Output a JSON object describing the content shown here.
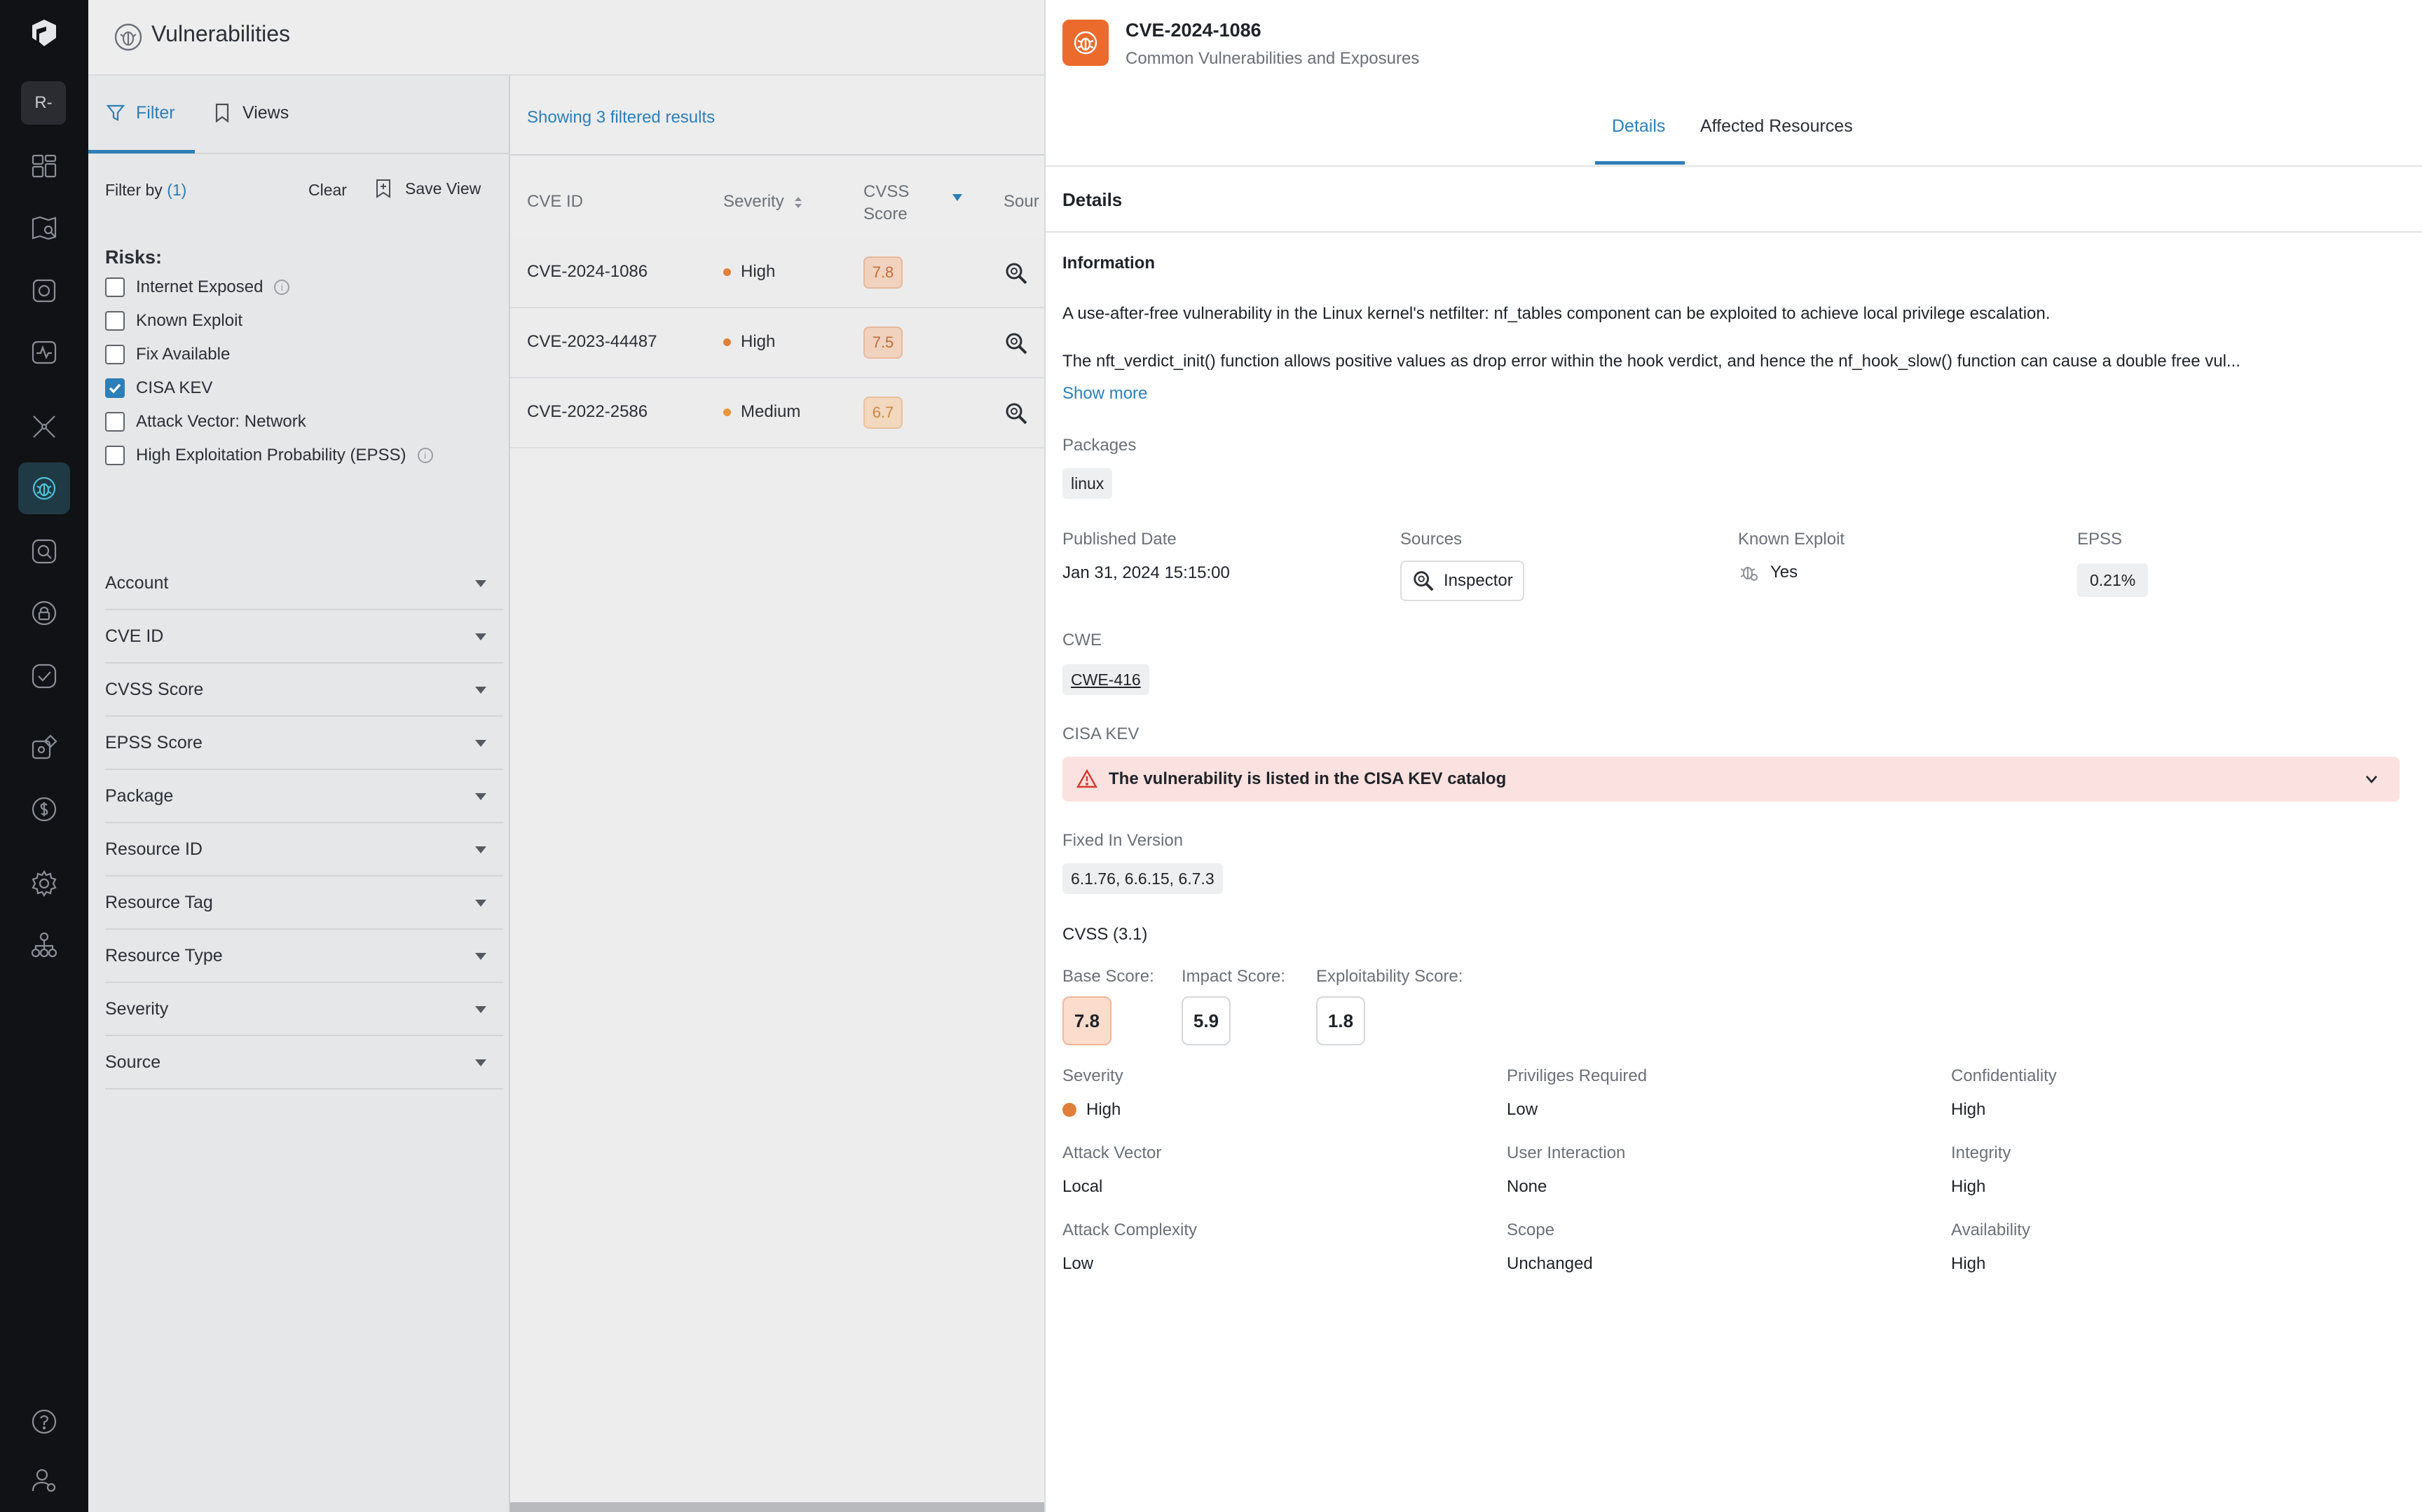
{
  "app": {
    "header_title": "Vulnerabilities",
    "workspace_badge": "R-"
  },
  "rail_icons": [
    "dashboard-icon",
    "inventory-map-icon",
    "vulnerabilities-scan-icon",
    "activity-icon",
    "network-icon",
    "bug-icon",
    "search-finding-icon",
    "lock-icon",
    "check-circle-icon",
    "integrations-icon",
    "cost-icon",
    "settings-icon",
    "organization-icon",
    "help-icon",
    "user-settings-icon"
  ],
  "filter_panel": {
    "tab_filter": "Filter",
    "tab_views": "Views",
    "filter_by": "Filter by",
    "filter_count": "(1)",
    "clear": "Clear",
    "save_view": "Save View",
    "risks_title": "Risks:",
    "risks": [
      {
        "label": "Internet Exposed",
        "checked": false,
        "info": true
      },
      {
        "label": "Known Exploit",
        "checked": false,
        "info": false
      },
      {
        "label": "Fix Available",
        "checked": false,
        "info": false
      },
      {
        "label": "CISA KEV",
        "checked": true,
        "info": false
      },
      {
        "label": "Attack Vector: Network",
        "checked": false,
        "info": false
      },
      {
        "label": "High Exploitation Probability (EPSS)",
        "checked": false,
        "info": true
      }
    ],
    "accordions": [
      "Account",
      "CVE ID",
      "CVSS Score",
      "EPSS Score",
      "Package",
      "Resource ID",
      "Resource Tag",
      "Resource Type",
      "Severity",
      "Source"
    ]
  },
  "table": {
    "showing": "Showing 3 filtered results",
    "columns": {
      "cve_id": "CVE ID",
      "severity": "Severity",
      "cvss_1": "CVSS",
      "cvss_2": "Score",
      "source": "Sour"
    },
    "rows": [
      {
        "cve": "CVE-2024-1086",
        "severity": "High",
        "score": "7.8"
      },
      {
        "cve": "CVE-2023-44487",
        "severity": "High",
        "score": "7.5"
      },
      {
        "cve": "CVE-2022-2586",
        "severity": "Medium",
        "score": "6.7"
      }
    ]
  },
  "drawer": {
    "title": "CVE-2024-1086",
    "subtitle": "Common Vulnerabilities and Exposures",
    "tabs": [
      "Details",
      "Affected Resources"
    ],
    "section": "Details",
    "information_label": "Information",
    "para1": "A use-after-free vulnerability in the Linux kernel's netfilter: nf_tables component can be exploited to achieve local privilege escalation.",
    "para2": "The nft_verdict_init() function allows positive values as drop error within the hook verdict, and hence the nf_hook_slow() function can cause a double free vul...",
    "show_more": "Show more",
    "packages_label": "Packages",
    "package": "linux",
    "published_label": "Published Date",
    "published": "Jan 31, 2024 15:15:00",
    "sources_label": "Sources",
    "source": "Inspector",
    "known_exploit_label": "Known Exploit",
    "known_exploit": "Yes",
    "epss_label": "EPSS",
    "epss": "0.21%",
    "cwe_label": "CWE",
    "cwe": "CWE-416",
    "cisa_label": "CISA KEV",
    "cisa_text": "The vulnerability is listed in the CISA KEV catalog",
    "fixed_label": "Fixed In Version",
    "fixed": "6.1.76, 6.6.15, 6.7.3",
    "cvss_title": "CVSS (3.1)",
    "base_label": "Base Score:",
    "base": "7.8",
    "impact_label": "Impact Score:",
    "impact": "5.9",
    "exploit_label": "Exploitability Score:",
    "exploit": "1.8",
    "metrics": {
      "severity_label": "Severity",
      "severity": "High",
      "priv_label": "Priviliges Required",
      "priv": "Low",
      "conf_label": "Confidentiality",
      "conf": "High",
      "av_label": "Attack Vector",
      "av": "Local",
      "ui_label": "User Interaction",
      "ui": "None",
      "int_label": "Integrity",
      "int": "High",
      "ac_label": "Attack Complexity",
      "ac": "Low",
      "scope_label": "Scope",
      "scope": "Unchanged",
      "avail_label": "Availability",
      "avail": "High"
    }
  },
  "colors": {
    "accent": "#2c7fb8",
    "high": "#e07f3a",
    "drawer_icon": "#ec6a2c",
    "kev_bg": "#fbe1df"
  }
}
